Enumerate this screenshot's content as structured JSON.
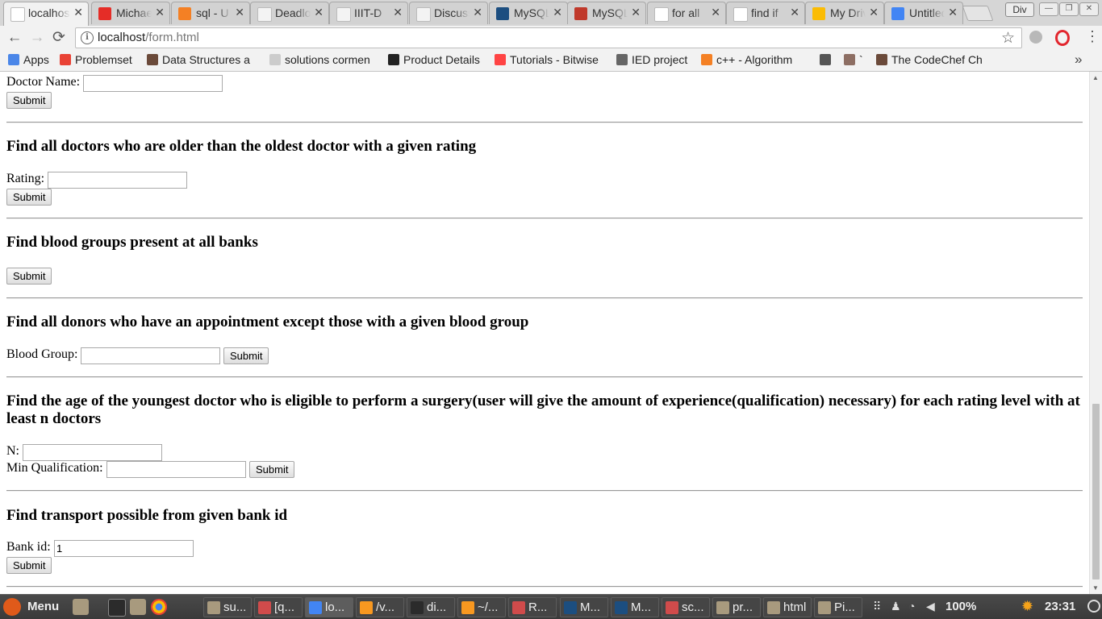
{
  "tabs": [
    {
      "title": "localhost/form.html",
      "icon": "page-icon",
      "color": "#ffffff",
      "active": true
    },
    {
      "title": "Michael",
      "icon": "youtube-icon",
      "color": "#e52d27"
    },
    {
      "title": "sql - U",
      "icon": "stackoverflow-icon",
      "color": "#f48024"
    },
    {
      "title": "Deadlock",
      "icon": "backpack-icon",
      "color": "#f3f3f3"
    },
    {
      "title": "IIIT-D",
      "icon": "backpack-icon",
      "color": "#f3f3f3"
    },
    {
      "title": "Discussion",
      "icon": "backpack-icon",
      "color": "#f3f3f3"
    },
    {
      "title": "MySQL",
      "icon": "mysql-icon",
      "color": "#1c4e80"
    },
    {
      "title": "MySQL",
      "icon": "mysql-icon",
      "color": "#c0392b"
    },
    {
      "title": "for all",
      "icon": "google-icon",
      "color": "#ffffff"
    },
    {
      "title": "find if",
      "icon": "google-icon",
      "color": "#ffffff"
    },
    {
      "title": "My Drive",
      "icon": "drive-icon",
      "color": "#fbbc04"
    },
    {
      "title": "Untitled",
      "icon": "docs-icon",
      "color": "#4285f4"
    }
  ],
  "window": {
    "profile": "Div",
    "minimize": "—",
    "maximize": "❐",
    "close": "✕"
  },
  "toolbar": {
    "back": "←",
    "forward": "→",
    "reload": "⟳",
    "url_host": "localhost",
    "url_path": "/form.html",
    "info": "i",
    "star": "☆",
    "menu": "⋮"
  },
  "bookmarks": {
    "items": [
      {
        "label": "Apps",
        "icon": "apps-grid-icon",
        "color": "#4a86e8"
      },
      {
        "label": "Problemset",
        "icon": "chart-icon",
        "color": "#e94235"
      },
      {
        "label": "Data Structures a",
        "icon": "codechef-icon",
        "color": "#6b4a3a"
      },
      {
        "label": "solutions cormen",
        "icon": "page-icon",
        "color": "#cccccc"
      },
      {
        "label": "Product Details",
        "icon": "amazon-icon",
        "color": "#222222"
      },
      {
        "label": "Tutorials - Bitwise",
        "icon": "cpp-icon",
        "color": "#ff4444"
      },
      {
        "label": "IED project",
        "icon": "folder-icon",
        "color": "#666666"
      },
      {
        "label": "c++ - Algorithm",
        "icon": "stackoverflow-icon",
        "color": "#f48024"
      },
      {
        "label": "",
        "icon": "iiitd-icon",
        "color": "#555555"
      },
      {
        "label": "`",
        "icon": "monkey-icon",
        "color": "#8d6e63"
      },
      {
        "label": "The CodeChef Ch",
        "icon": "codechef-icon",
        "color": "#6b4a3a"
      }
    ],
    "more": "»"
  },
  "page": {
    "doctor_name_label": "Doctor Name:",
    "submit": "Submit",
    "section_rating": {
      "heading": "Find all doctors who are older than the oldest doctor with a given rating",
      "label": "Rating:"
    },
    "section_blood_banks": {
      "heading": "Find blood groups present at all banks"
    },
    "section_donors": {
      "heading": "Find all donors who have an appointment except those with a given blood group",
      "label": "Blood Group:"
    },
    "section_youngest": {
      "heading": "Find the age of the youngest doctor who is eligible to perform a surgery(user will give the amount of experience(qualification) necessary) for each rating level with at least n doctors",
      "label_n": "N:",
      "label_qual": "Min Qualification:"
    },
    "section_transport": {
      "heading": "Find transport possible from given bank id",
      "label": "Bank id:",
      "value": "1"
    }
  },
  "taskbar": {
    "menu_label": "Menu",
    "items": [
      {
        "label": "su...",
        "icon": "folder-icon",
        "color": "#a89a7e"
      },
      {
        "label": "[q...",
        "icon": "editor-icon",
        "color": "#d04b4b"
      },
      {
        "label": "lo...",
        "icon": "chrome-icon",
        "color": "#4285f4",
        "active": true
      },
      {
        "label": "/v...",
        "icon": "sublime-icon",
        "color": "#f89820"
      },
      {
        "label": "di...",
        "icon": "terminal-icon",
        "color": "#2b2b2b"
      },
      {
        "label": "~/...",
        "icon": "sublime-icon",
        "color": "#f89820"
      },
      {
        "label": "R...",
        "icon": "editor-icon",
        "color": "#d04b4b"
      },
      {
        "label": "M...",
        "icon": "mysql-workbench-icon",
        "color": "#1c4e80"
      },
      {
        "label": "M...",
        "icon": "mysql-workbench-icon",
        "color": "#1c4e80"
      },
      {
        "label": "sc...",
        "icon": "editor-icon",
        "color": "#d04b4b"
      },
      {
        "label": "pr...",
        "icon": "folder-icon",
        "color": "#a89a7e"
      },
      {
        "label": "html",
        "icon": "folder-icon",
        "color": "#a89a7e"
      },
      {
        "label": "Pi...",
        "icon": "folder-icon",
        "color": "#a89a7e"
      }
    ],
    "battery": "100%",
    "clock": "23:31"
  }
}
